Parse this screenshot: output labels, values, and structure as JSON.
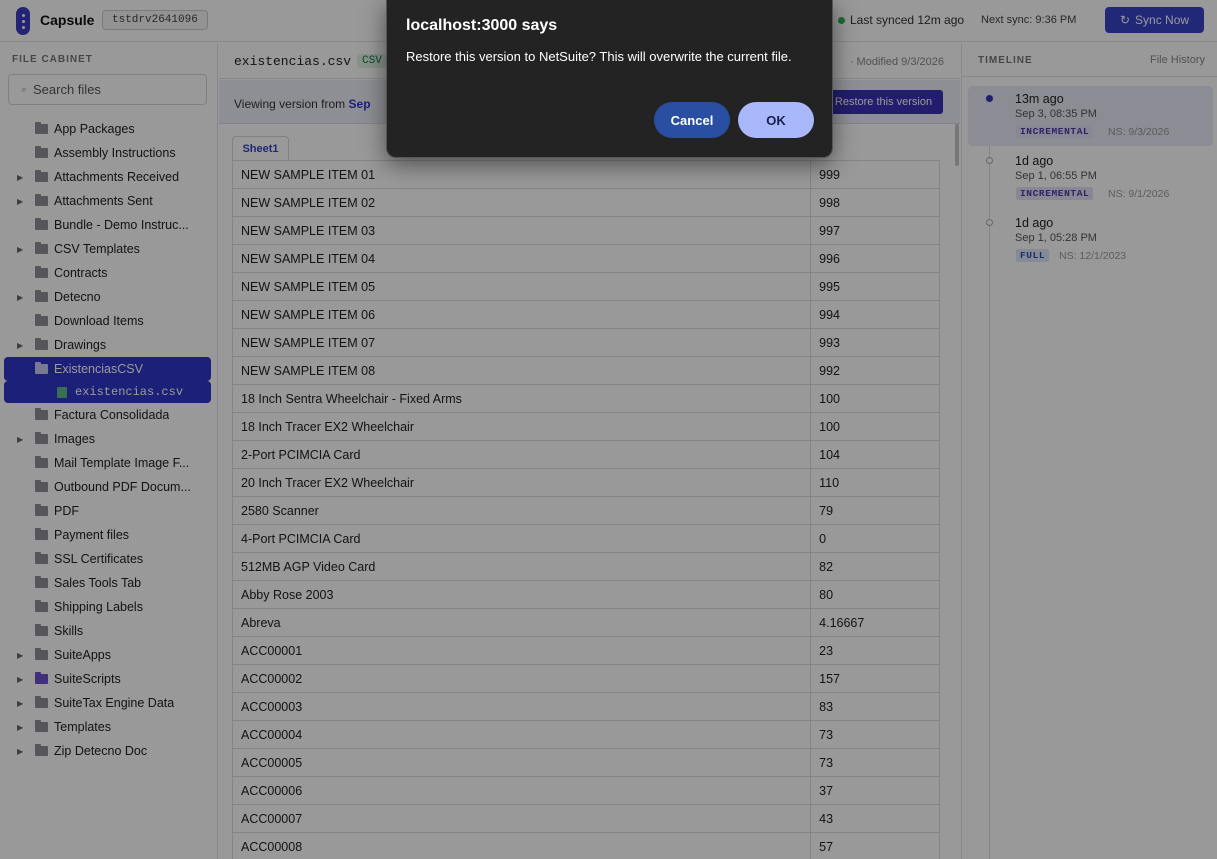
{
  "header": {
    "app_name": "Capsule",
    "tenant": "tstdrv2641096",
    "last_synced": "Last synced 12m ago",
    "next_sync": "Next sync: 9:36 PM",
    "sync_button": "Sync Now"
  },
  "sidebar": {
    "title": "FILE CABINET",
    "search_placeholder": "Search files",
    "items": [
      {
        "label": "App Packages",
        "expandable": false
      },
      {
        "label": "Assembly Instructions",
        "expandable": false
      },
      {
        "label": "Attachments Received",
        "expandable": true
      },
      {
        "label": "Attachments Sent",
        "expandable": true
      },
      {
        "label": "Bundle - Demo Instruc...",
        "expandable": false
      },
      {
        "label": "CSV Templates",
        "expandable": true
      },
      {
        "label": "Contracts",
        "expandable": false
      },
      {
        "label": "Detecno",
        "expandable": true
      },
      {
        "label": "Download Items",
        "expandable": false
      },
      {
        "label": "Drawings",
        "expandable": true
      },
      {
        "label": "ExistenciasCSV",
        "expandable": false,
        "selected": true
      },
      {
        "label": "existencias.csv",
        "file": true
      },
      {
        "label": "Factura Consolidada",
        "expandable": false
      },
      {
        "label": "Images",
        "expandable": true
      },
      {
        "label": "Mail Template Image F...",
        "expandable": false
      },
      {
        "label": "Outbound PDF Docum...",
        "expandable": false
      },
      {
        "label": "PDF",
        "expandable": false
      },
      {
        "label": "Payment files",
        "expandable": false
      },
      {
        "label": "SSL Certificates",
        "expandable": false
      },
      {
        "label": "Sales Tools Tab",
        "expandable": false
      },
      {
        "label": "Shipping Labels",
        "expandable": false
      },
      {
        "label": "Skills",
        "expandable": false
      },
      {
        "label": "SuiteApps",
        "expandable": true
      },
      {
        "label": "SuiteScripts",
        "expandable": true,
        "special": true
      },
      {
        "label": "SuiteTax Engine Data",
        "expandable": true
      },
      {
        "label": "Templates",
        "expandable": true
      },
      {
        "label": "Zip Detecno Doc",
        "expandable": true
      }
    ]
  },
  "main": {
    "filename": "existencias.csv",
    "badge": "CSV",
    "modified": "· Modified 9/3/2026",
    "version_prefix": "Viewing version from",
    "version_date": "Sep",
    "restore_button": "Restore this version",
    "sheet_tab": "Sheet1",
    "rows": [
      [
        "NEW SAMPLE ITEM 01",
        "999"
      ],
      [
        "NEW SAMPLE ITEM 02",
        "998"
      ],
      [
        "NEW SAMPLE ITEM 03",
        "997"
      ],
      [
        "NEW SAMPLE ITEM 04",
        "996"
      ],
      [
        "NEW SAMPLE ITEM 05",
        "995"
      ],
      [
        "NEW SAMPLE ITEM 06",
        "994"
      ],
      [
        "NEW SAMPLE ITEM 07",
        "993"
      ],
      [
        "NEW SAMPLE ITEM 08",
        "992"
      ],
      [
        "18 Inch Sentra Wheelchair - Fixed Arms",
        "100"
      ],
      [
        "18 Inch Tracer EX2 Wheelchair",
        "100"
      ],
      [
        "2-Port PCIMCIA Card",
        "104"
      ],
      [
        "20 Inch Tracer EX2 Wheelchair",
        "110"
      ],
      [
        "2580 Scanner",
        "79"
      ],
      [
        "4-Port PCIMCIA Card",
        "0"
      ],
      [
        "512MB AGP Video Card",
        "82"
      ],
      [
        "Abby Rose 2003",
        "80"
      ],
      [
        "Abreva",
        "4.16667"
      ],
      [
        "ACC00001",
        "23"
      ],
      [
        "ACC00002",
        "157"
      ],
      [
        "ACC00003",
        "83"
      ],
      [
        "ACC00004",
        "73"
      ],
      [
        "ACC00005",
        "73"
      ],
      [
        "ACC00006",
        "37"
      ],
      [
        "ACC00007",
        "43"
      ],
      [
        "ACC00008",
        "57"
      ]
    ]
  },
  "timeline": {
    "title": "TIMELINE",
    "subtitle": "File History",
    "entries": [
      {
        "ago": "13m ago",
        "date": "Sep 3, 08:35 PM",
        "type": "INCREMENTAL",
        "ns": "NS: 9/3/2026",
        "active": true
      },
      {
        "ago": "1d ago",
        "date": "Sep 1, 06:55 PM",
        "type": "INCREMENTAL",
        "ns": "NS: 9/1/2026",
        "active": false
      },
      {
        "ago": "1d ago",
        "date": "Sep 1, 05:28 PM",
        "type": "FULL",
        "ns": "NS: 12/1/2023",
        "active": false
      }
    ]
  },
  "dialog": {
    "title": "localhost:3000 says",
    "message": "Restore this version to NetSuite? This will overwrite the current file.",
    "cancel": "Cancel",
    "ok": "OK"
  }
}
